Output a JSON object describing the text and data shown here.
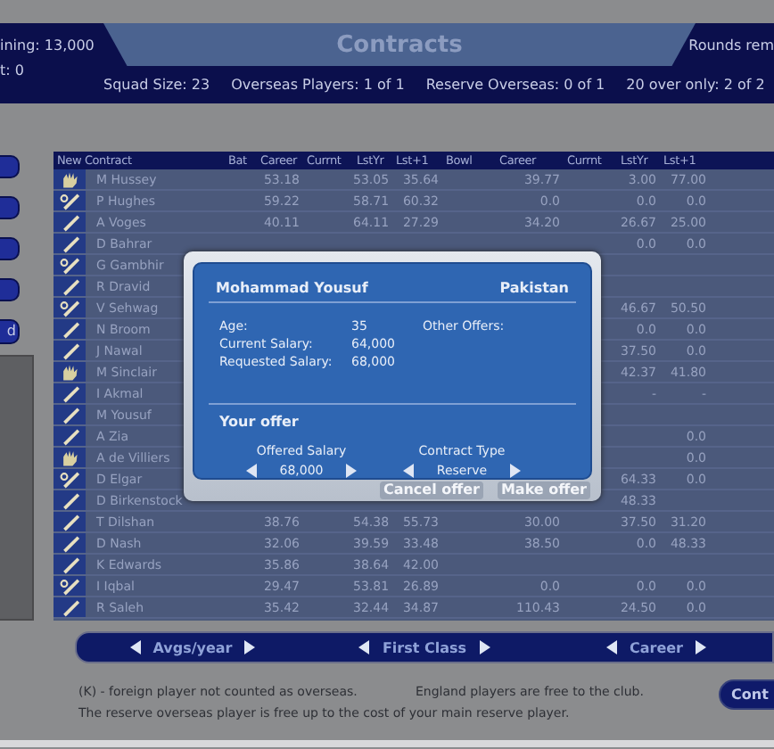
{
  "top_bar": {
    "left_lines": [
      "ining: 13,000",
      "t: 0"
    ],
    "title": "Contracts",
    "right_text": "Rounds rem",
    "stats": [
      "Squad Size: 23",
      "Overseas Players: 1 of 1",
      "Reserve Overseas: 0 of 1",
      "20 over only: 2 of 2"
    ]
  },
  "side_buttons": [
    {
      "kind": "blank"
    },
    {
      "kind": "blank"
    },
    {
      "kind": "blank"
    },
    {
      "kind": "blank"
    },
    {
      "kind": "label",
      "label": "d"
    }
  ],
  "table": {
    "columns": [
      "New Contract",
      "Bat",
      "Career",
      "Currnt",
      "LstYr",
      "Lst+1",
      "Bowl",
      "Career",
      "Currnt",
      "LstYr",
      "Lst+1"
    ],
    "rows": [
      {
        "name": "M Hussey",
        "kind": "keeper",
        "values": {
          "bat_career": "53.18",
          "bat_lstyr": "53.05",
          "bat_lst1": "35.64",
          "bowl_career": "39.77",
          "bowl_lstyr": "3.00",
          "bowl_lst1": "77.00"
        }
      },
      {
        "name": "P Hughes",
        "kind": "allround",
        "values": {
          "bat_career": "59.22",
          "bat_lstyr": "58.71",
          "bat_lst1": "60.32",
          "bowl_career": "0.0",
          "bowl_lstyr": "0.0",
          "bowl_lst1": "0.0"
        }
      },
      {
        "name": "A Voges",
        "kind": "bat",
        "values": {
          "bat_career": "40.11",
          "bat_lstyr": "64.11",
          "bat_lst1": "27.29",
          "bowl_career": "34.20",
          "bowl_lstyr": "26.67",
          "bowl_lst1": "25.00"
        }
      },
      {
        "name": "D Bahrar",
        "kind": "bat",
        "values": {
          "bowl_lstyr": "0.0",
          "bowl_lst1": "0.0"
        }
      },
      {
        "name": "G Gambhir",
        "kind": "allround",
        "values": {}
      },
      {
        "name": "R Dravid",
        "kind": "bat",
        "values": {}
      },
      {
        "name": "V Sehwag",
        "kind": "allround",
        "values": {
          "bowl_lstyr": "46.67",
          "bowl_lst1": "50.50"
        }
      },
      {
        "name": "N Broom",
        "kind": "bat",
        "values": {
          "bowl_lstyr": "0.0",
          "bowl_lst1": "0.0"
        }
      },
      {
        "name": "J Nawal",
        "kind": "bat",
        "values": {
          "bowl_lstyr": "37.50",
          "bowl_lst1": "0.0"
        }
      },
      {
        "name": "M Sinclair",
        "kind": "keeper",
        "values": {
          "bowl_lstyr": "42.37",
          "bowl_lst1": "41.80"
        }
      },
      {
        "name": "I Akmal",
        "kind": "bat",
        "values": {
          "bowl_lstyr": "-",
          "bowl_lst1": "-"
        }
      },
      {
        "name": "M Yousuf",
        "kind": "bat",
        "values": {}
      },
      {
        "name": "A Zia",
        "kind": "bat",
        "values": {
          "bowl_lst1": "0.0"
        }
      },
      {
        "name": "A de Villiers",
        "kind": "keeper",
        "values": {
          "bowl_lst1": "0.0"
        }
      },
      {
        "name": "D Elgar",
        "kind": "allround",
        "values": {
          "bowl_lstyr": "64.33",
          "bowl_lst1": "0.0"
        }
      },
      {
        "name": "D Birkenstock",
        "kind": "bat",
        "values": {
          "bowl_lstyr": "48.33"
        }
      },
      {
        "name": "T Dilshan",
        "kind": "bat",
        "values": {
          "bat_career": "38.76",
          "bat_lstyr": "54.38",
          "bat_lst1": "55.73",
          "bowl_career": "30.00",
          "bowl_lstyr": "37.50",
          "bowl_lst1": "31.20"
        }
      },
      {
        "name": "D Nash",
        "kind": "bat",
        "values": {
          "bat_career": "32.06",
          "bat_lstyr": "39.59",
          "bat_lst1": "33.48",
          "bowl_career": "38.50",
          "bowl_lstyr": "0.0",
          "bowl_lst1": "48.33"
        }
      },
      {
        "name": "K Edwards",
        "kind": "bat",
        "values": {
          "bat_career": "35.86",
          "bat_lstyr": "38.64",
          "bat_lst1": "42.00"
        }
      },
      {
        "name": "I Iqbal",
        "kind": "allround",
        "values": {
          "bat_career": "29.47",
          "bat_lstyr": "53.81",
          "bat_lst1": "26.89",
          "bowl_career": "0.0",
          "bowl_lstyr": "0.0",
          "bowl_lst1": "0.0"
        }
      },
      {
        "name": "R Saleh",
        "kind": "bat",
        "values": {
          "bat_career": "35.42",
          "bat_lstyr": "32.44",
          "bat_lst1": "34.87",
          "bowl_career": "110.43",
          "bowl_lstyr": "24.50",
          "bowl_lst1": "0.0"
        }
      }
    ]
  },
  "dialog": {
    "player": "Mohammad Yousuf",
    "country": "Pakistan",
    "fields": [
      {
        "label": "Age:",
        "value": "35"
      },
      {
        "label": "Current Salary:",
        "value": "64,000"
      },
      {
        "label": "Requested Salary:",
        "value": "68,000"
      }
    ],
    "other_offers": "Other Offers:",
    "offer_heading": "Your offer",
    "spinners": [
      {
        "label": "Offered Salary",
        "value": "68,000"
      },
      {
        "label": "Contract Type",
        "value": "Reserve"
      }
    ],
    "buttons": [
      "Cancel offer",
      "Make offer"
    ]
  },
  "view_switchers": [
    "Avgs/year",
    "First Class",
    "Career"
  ],
  "notes": {
    "line_1_left": "(K) - foreign player not counted as overseas.",
    "line_1_right": "England players are free to the club.",
    "line_2": "The reserve overseas player is free up to the cost of your main reserve player."
  },
  "continue_button": "Cont"
}
